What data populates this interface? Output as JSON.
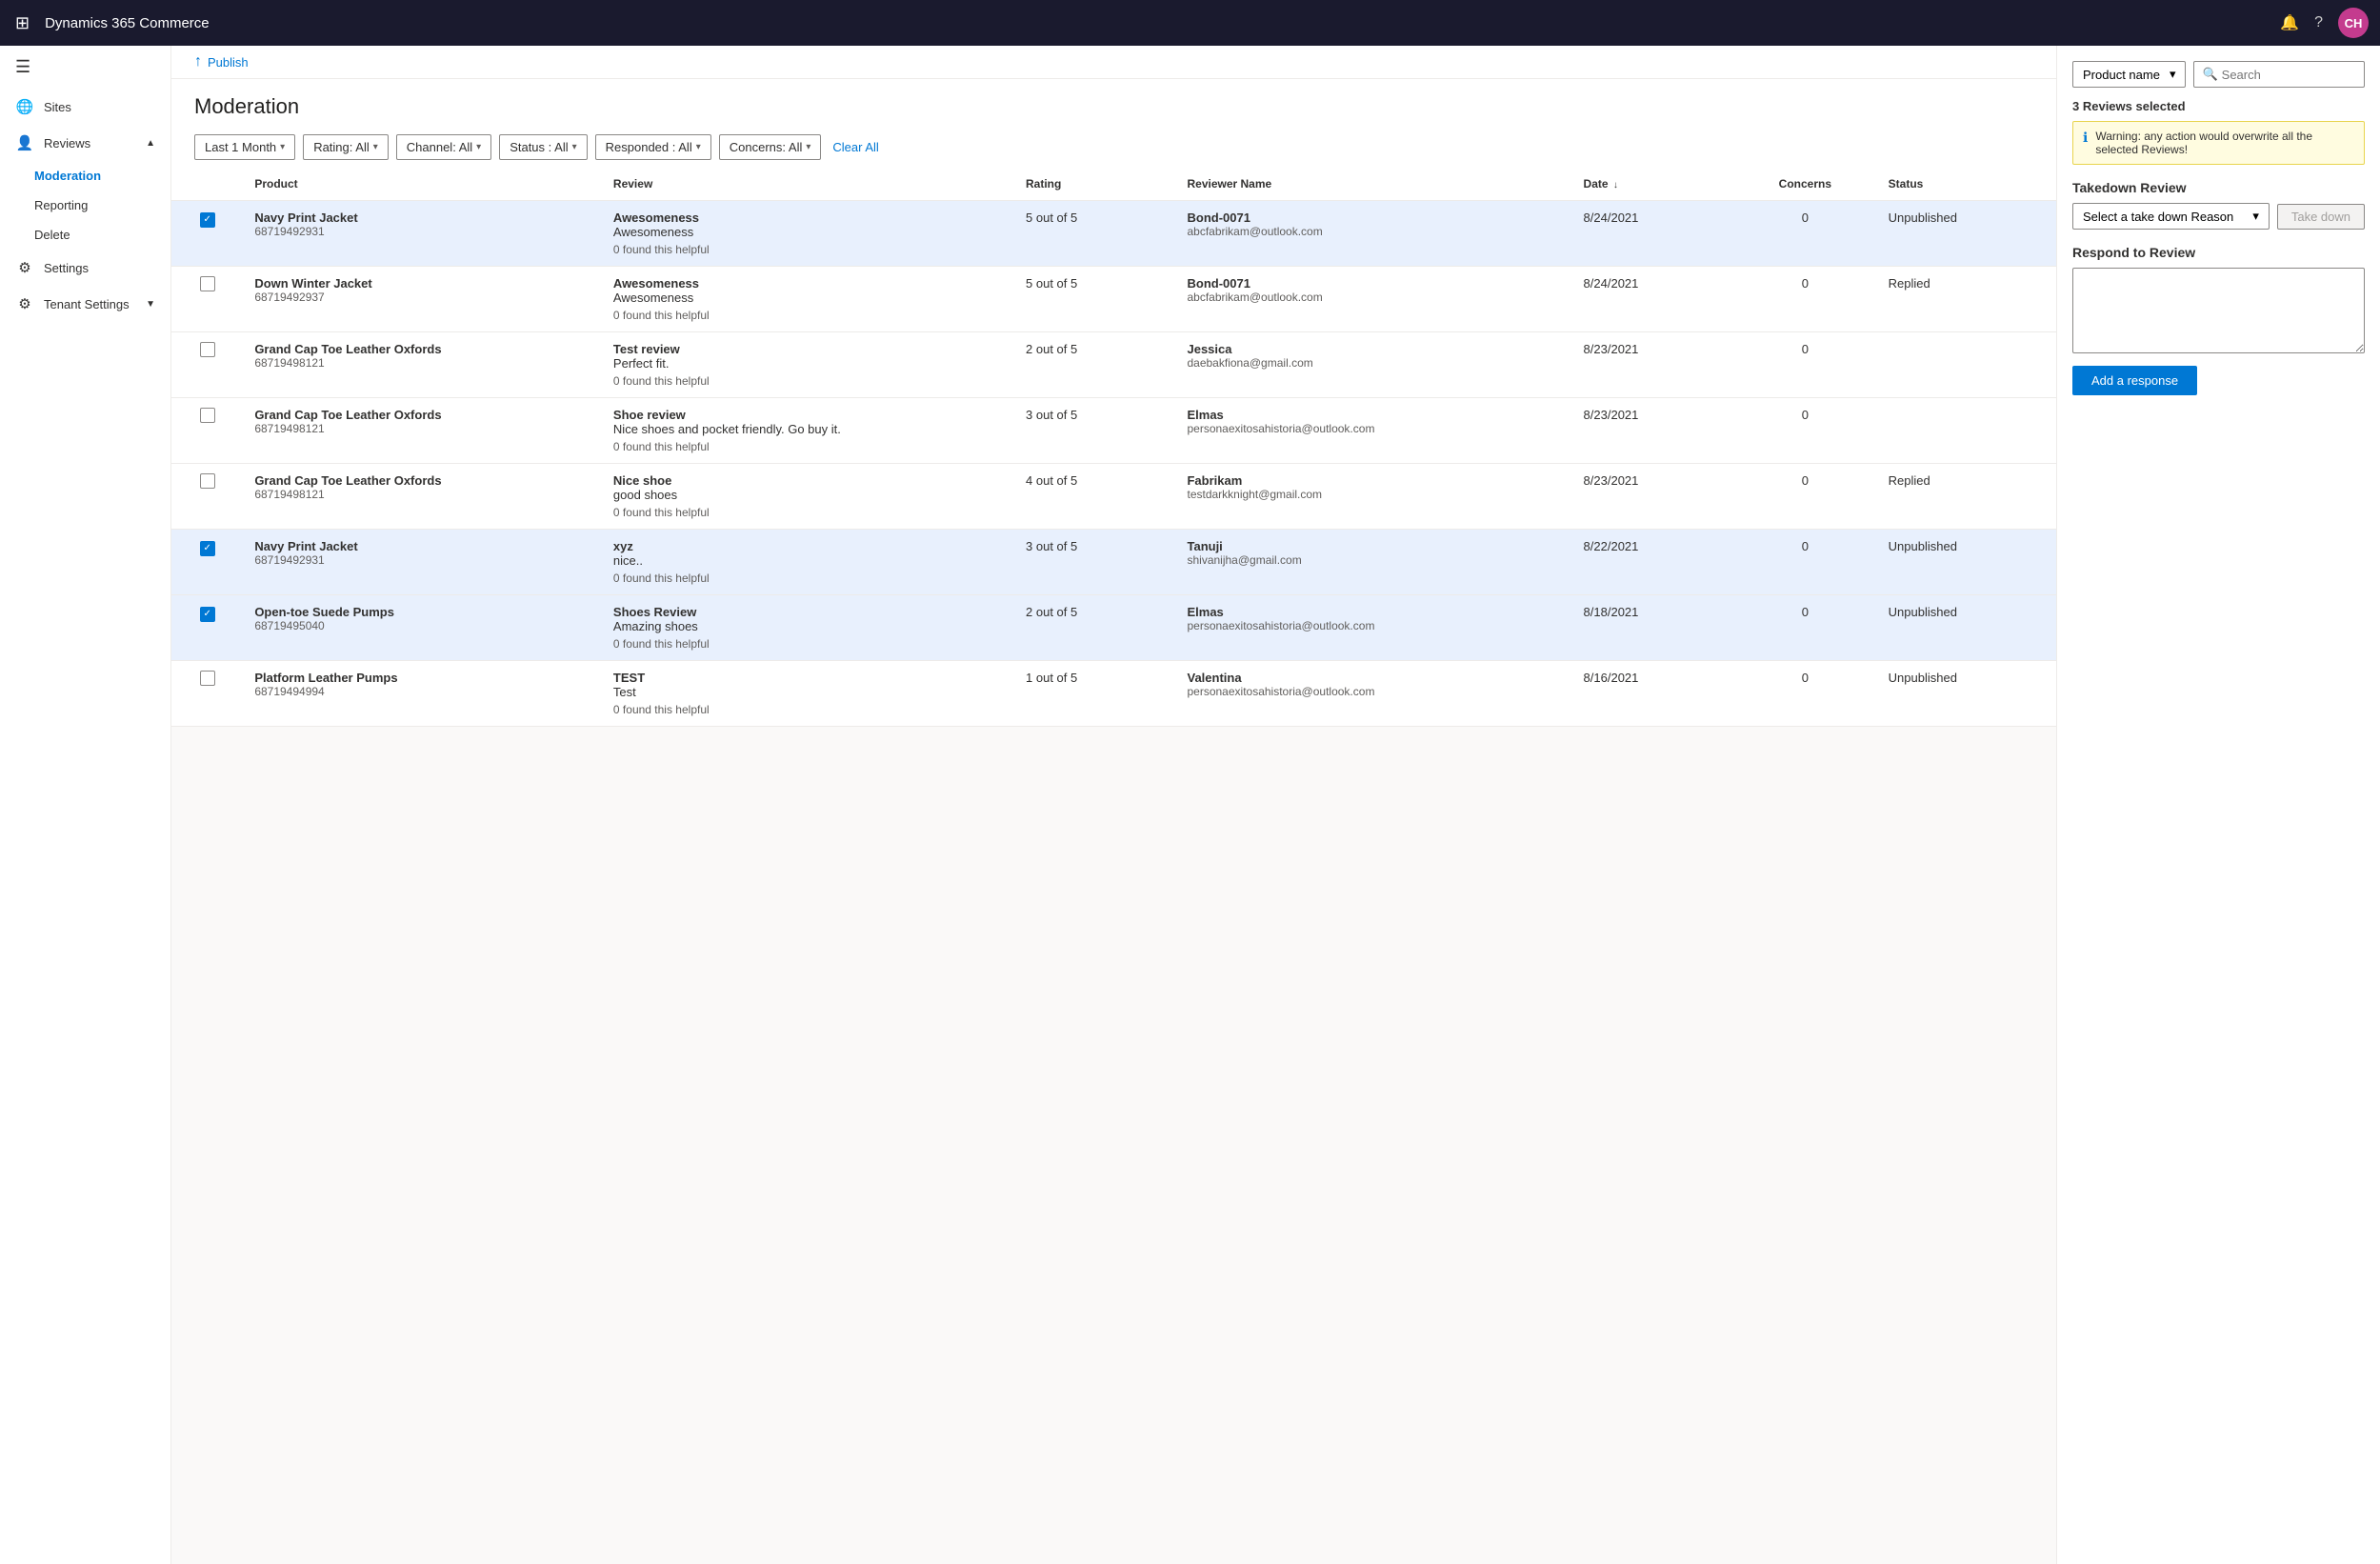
{
  "topnav": {
    "app_title": "Dynamics 365 Commerce",
    "waffle_icon": "⊞",
    "bell_icon": "🔔",
    "help_icon": "?",
    "avatar_initials": "CH"
  },
  "sidebar": {
    "hamburger": "☰",
    "items": [
      {
        "id": "sites",
        "label": "Sites",
        "icon": "🌐"
      },
      {
        "id": "reviews",
        "label": "Reviews",
        "icon": "👤",
        "expanded": true
      },
      {
        "id": "moderation",
        "label": "Moderation",
        "active": true
      },
      {
        "id": "reporting",
        "label": "Reporting"
      },
      {
        "id": "delete",
        "label": "Delete"
      },
      {
        "id": "settings",
        "label": "Settings"
      },
      {
        "id": "tenant-settings",
        "label": "Tenant Settings",
        "icon": "⚙",
        "expandable": true
      }
    ]
  },
  "publish_bar": {
    "arrow": "↑",
    "label": "Publish"
  },
  "page": {
    "title": "Moderation"
  },
  "filters": {
    "date": "Last 1 Month",
    "rating": "Rating: All",
    "channel": "Channel: All",
    "status": "Status : All",
    "responded": "Responded : All",
    "concerns": "Concerns: All",
    "clear_all": "Clear All"
  },
  "table": {
    "columns": [
      "",
      "Product",
      "Review",
      "Rating",
      "Reviewer Name",
      "Date ↓",
      "Concerns",
      "Status"
    ],
    "rows": [
      {
        "selected": true,
        "product_name": "Navy Print Jacket",
        "product_id": "68719492931",
        "review_title": "Awesomeness",
        "review_body": "Awesomeness",
        "helpful": "0 found this helpful",
        "rating": "5 out of 5",
        "reviewer_name": "Bond-0071",
        "reviewer_email": "abcfabrikam@outlook.com",
        "date": "8/24/2021",
        "concerns": "0",
        "status": "Unpublished"
      },
      {
        "selected": false,
        "product_name": "Down Winter Jacket",
        "product_id": "68719492937",
        "review_title": "Awesomeness",
        "review_body": "Awesomeness",
        "helpful": "0 found this helpful",
        "rating": "5 out of 5",
        "reviewer_name": "Bond-0071",
        "reviewer_email": "abcfabrikam@outlook.com",
        "date": "8/24/2021",
        "concerns": "0",
        "status": "Replied"
      },
      {
        "selected": false,
        "product_name": "Grand Cap Toe Leather Oxfords",
        "product_id": "68719498121",
        "review_title": "Test review",
        "review_body": "Perfect fit.",
        "helpful": "0 found this helpful",
        "rating": "2 out of 5",
        "reviewer_name": "Jessica",
        "reviewer_email": "daebakfiona@gmail.com",
        "date": "8/23/2021",
        "concerns": "0",
        "status": ""
      },
      {
        "selected": false,
        "product_name": "Grand Cap Toe Leather Oxfords",
        "product_id": "68719498121",
        "review_title": "Shoe review",
        "review_body": "Nice shoes and pocket friendly. Go buy it.",
        "helpful": "0 found this helpful",
        "rating": "3 out of 5",
        "reviewer_name": "Elmas",
        "reviewer_email": "personaexitosahistoria@outlook.com",
        "date": "8/23/2021",
        "concerns": "0",
        "status": ""
      },
      {
        "selected": false,
        "product_name": "Grand Cap Toe Leather Oxfords",
        "product_id": "68719498121",
        "review_title": "Nice shoe",
        "review_body": "good shoes",
        "helpful": "0 found this helpful",
        "rating": "4 out of 5",
        "reviewer_name": "Fabrikam",
        "reviewer_email": "testdarkknight@gmail.com",
        "date": "8/23/2021",
        "concerns": "0",
        "status": "Replied"
      },
      {
        "selected": true,
        "product_name": "Navy Print Jacket",
        "product_id": "68719492931",
        "review_title": "xyz",
        "review_body": "nice..",
        "helpful": "0 found this helpful",
        "rating": "3 out of 5",
        "reviewer_name": "Tanuji",
        "reviewer_email": "shivanijha@gmail.com",
        "date": "8/22/2021",
        "concerns": "0",
        "status": "Unpublished"
      },
      {
        "selected": true,
        "product_name": "Open-toe Suede Pumps",
        "product_id": "68719495040",
        "review_title": "Shoes Review",
        "review_body": "Amazing shoes",
        "helpful": "0 found this helpful",
        "rating": "2 out of 5",
        "reviewer_name": "Elmas",
        "reviewer_email": "personaexitosahistoria@outlook.com",
        "date": "8/18/2021",
        "concerns": "0",
        "status": "Unpublished"
      },
      {
        "selected": false,
        "product_name": "Platform Leather Pumps",
        "product_id": "68719494994",
        "review_title": "TEST",
        "review_body": "Test",
        "helpful": "0 found this helpful",
        "rating": "1 out of 5",
        "reviewer_name": "Valentina",
        "reviewer_email": "personaexitosahistoria@outlook.com",
        "date": "8/16/2021",
        "concerns": "0",
        "status": "Unpublished"
      }
    ]
  },
  "right_panel": {
    "product_name_label": "Product name",
    "search_placeholder": "Search",
    "selected_count": "3 Reviews selected",
    "warning_text": "Warning: any action would overwrite all the selected Reviews!",
    "takedown_title": "Takedown Review",
    "takedown_placeholder": "Select a take down Reason",
    "takedown_btn": "Take down",
    "respond_title": "Respond to Review",
    "add_response_btn": "Add a response"
  }
}
